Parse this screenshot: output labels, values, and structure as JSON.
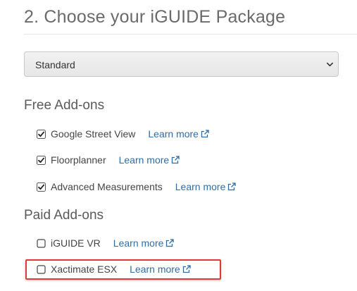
{
  "section_title": "2. Choose your iGUIDE Package",
  "package_select": {
    "selected": "Standard",
    "icon": "chevron-down-icon"
  },
  "free_addons": {
    "heading": "Free Add-ons",
    "items": [
      {
        "label": "Google Street View",
        "checked": true,
        "link": "Learn more"
      },
      {
        "label": "Floorplanner",
        "checked": true,
        "link": "Learn more"
      },
      {
        "label": "Advanced Measurements",
        "checked": true,
        "link": "Learn more"
      }
    ]
  },
  "paid_addons": {
    "heading": "Paid Add-ons",
    "items": [
      {
        "label": "iGUIDE VR",
        "checked": false,
        "link": "Learn more"
      },
      {
        "label": "Xactimate ESX",
        "checked": false,
        "link": "Learn more",
        "highlighted": true
      }
    ]
  },
  "colors": {
    "title": "#6a6a6a",
    "link": "#2d6da8",
    "highlight": "#de3a3a"
  }
}
